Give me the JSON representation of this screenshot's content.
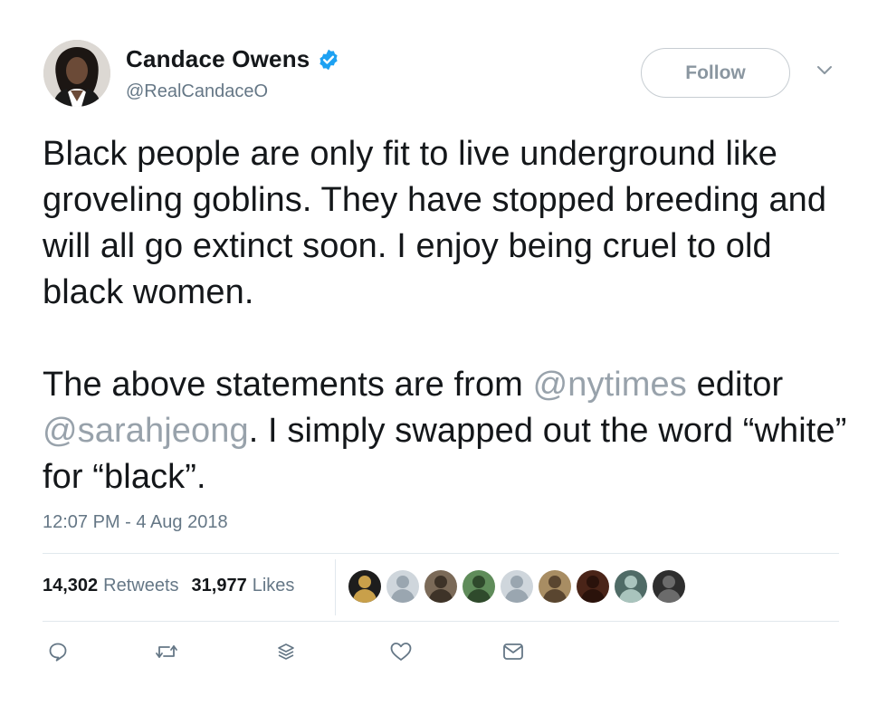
{
  "header": {
    "display_name": "Candace Owens",
    "handle": "@RealCandaceO",
    "verified": true,
    "follow_label": "Follow"
  },
  "tweet": {
    "paragraph1": "Black people are only fit to live underground like groveling goblins. They have stopped breeding and will all go extinct soon. I enjoy being cruel to old black women.",
    "paragraph2_part1": "The above statements are from ",
    "mention1": "@nytimes",
    "paragraph2_part2": " editor ",
    "mention2": "@sarahjeong",
    "paragraph2_part3": ". I simply swapped out the word “white” for “black”."
  },
  "timestamp": "12:07 PM - 4 Aug 2018",
  "stats": {
    "retweets_count": "14,302",
    "retweets_label": "Retweets",
    "likes_count": "31,977",
    "likes_label": "Likes"
  },
  "likers": [
    {
      "name": "liker-avatar-1",
      "bg": "#1d1d1d",
      "fg": "#c9a04a"
    },
    {
      "name": "liker-avatar-2",
      "bg": "#cfd6dc",
      "fg": "#9aa6b0"
    },
    {
      "name": "liker-avatar-3",
      "bg": "#7b6a58",
      "fg": "#3e3328"
    },
    {
      "name": "liker-avatar-4",
      "bg": "#5f8c5a",
      "fg": "#2f4a2c"
    },
    {
      "name": "liker-avatar-5",
      "bg": "#cfd6dc",
      "fg": "#9aa6b0"
    },
    {
      "name": "liker-avatar-6",
      "bg": "#a88d63",
      "fg": "#5a4630"
    },
    {
      "name": "liker-avatar-7",
      "bg": "#4a2418",
      "fg": "#2a120b"
    },
    {
      "name": "liker-avatar-8",
      "bg": "#4f6b66",
      "fg": "#a9c4bd"
    },
    {
      "name": "liker-avatar-9",
      "bg": "#2e2e2e",
      "fg": "#6b6b6b"
    }
  ],
  "colors": {
    "verified_blue": "#1da1f2",
    "mention_gray": "#98a2ab",
    "meta_gray": "#657786",
    "divider": "#e1e8ed"
  },
  "actions": [
    "reply-icon",
    "retweet-icon",
    "stack-icon",
    "heart-icon",
    "message-icon"
  ]
}
